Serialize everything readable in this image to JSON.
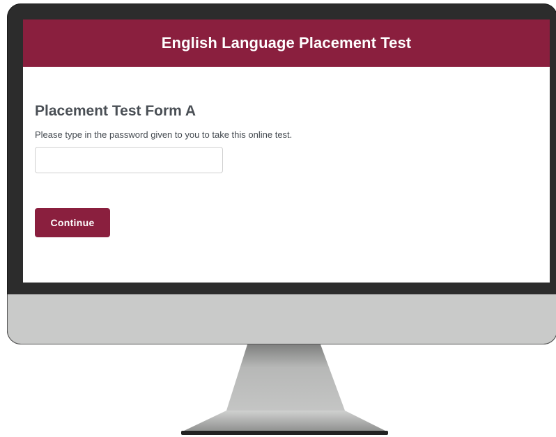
{
  "header": {
    "title": "English Language Placement Test"
  },
  "form": {
    "title": "Placement Test Form A",
    "instructions": "Please type in the password given to you to take this online test.",
    "password_value": "",
    "password_placeholder": "",
    "continue_label": "Continue"
  },
  "colors": {
    "brand": "#8a1f3e",
    "monitor_bezel": "#2c2c2c",
    "monitor_chin": "#c9cac9"
  }
}
